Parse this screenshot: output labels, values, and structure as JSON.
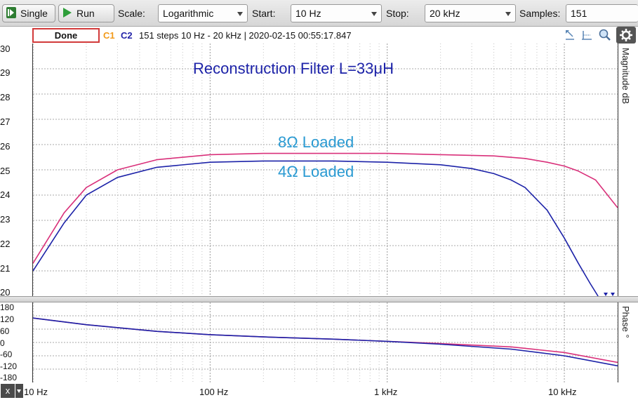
{
  "toolbar": {
    "single_label": "Single",
    "run_label": "Run",
    "scale_label": "Scale:",
    "scale_value": "Logarithmic",
    "start_label": "Start:",
    "start_value": "10 Hz",
    "stop_label": "Stop:",
    "stop_value": "20 kHz",
    "samples_label": "Samples:",
    "samples_value": "151"
  },
  "status": {
    "state": "Done",
    "c1": "C1",
    "c2": "C2",
    "info": "151 steps  10 Hz - 20 kHz | 2020-02-15 00:55:17.847",
    "icons": [
      "cursor-left-icon",
      "cursor-baseline-icon",
      "zoom-icon",
      "gear-icon"
    ]
  },
  "colors": {
    "c1": "#f29a1a",
    "c2": "#2323a8",
    "trace_8ohm": "#d9307a",
    "trace_4ohm": "#1c22a8",
    "annotation_title": "#1c22a8",
    "annotation_loads": "#2a9ad2"
  },
  "annotations": {
    "title": "Reconstruction   Filter L=33μH",
    "load_8": "8Ω  Loaded",
    "load_4": "4Ω  Loaded"
  },
  "axes": {
    "mag_label": "Magnitude dB",
    "phase_label": "Phase °",
    "x_ticks": [
      "10 Hz",
      "100 Hz",
      "1 kHz",
      "10 kHz"
    ],
    "mag_ticks": [
      "30",
      "29",
      "28",
      "27",
      "26",
      "25",
      "24",
      "23",
      "22",
      "21",
      "20"
    ],
    "phase_ticks": [
      "180",
      "120",
      "60",
      "0",
      "-60",
      "-120",
      "-180"
    ]
  },
  "bottom": {
    "x_button": "x"
  },
  "chart_data": [
    {
      "type": "line",
      "xscale": "log",
      "xlim": [
        10,
        20000
      ],
      "ylim": [
        20,
        30
      ],
      "ylabel": "Magnitude dB",
      "series": [
        {
          "name": "8Ω  Loaded",
          "color": "#d9307a",
          "x": [
            10,
            15,
            20,
            30,
            50,
            100,
            200,
            500,
            1000,
            2000,
            4000,
            6000,
            8000,
            10000,
            12000,
            15000,
            20000
          ],
          "y": [
            21.3,
            23.3,
            24.3,
            25.0,
            25.4,
            25.6,
            25.65,
            25.65,
            25.65,
            25.6,
            25.55,
            25.45,
            25.3,
            25.15,
            24.95,
            24.6,
            23.5
          ]
        },
        {
          "name": "4Ω  Loaded",
          "color": "#1c22a8",
          "x": [
            10,
            15,
            20,
            30,
            50,
            100,
            200,
            500,
            1000,
            2000,
            3000,
            4000,
            5000,
            6000,
            8000,
            10000,
            12000,
            14000,
            15500
          ],
          "y": [
            21.0,
            22.9,
            24.0,
            24.7,
            25.1,
            25.3,
            25.35,
            25.35,
            25.3,
            25.2,
            25.05,
            24.85,
            24.6,
            24.3,
            23.4,
            22.3,
            21.3,
            20.5,
            20.0
          ]
        }
      ]
    },
    {
      "type": "line",
      "xscale": "log",
      "xlim": [
        10,
        20000
      ],
      "ylim": [
        -180,
        180
      ],
      "ylabel": "Phase °",
      "series": [
        {
          "name": "8Ω  Loaded",
          "color": "#d9307a",
          "x": [
            10,
            20,
            50,
            100,
            200,
            500,
            1000,
            2000,
            5000,
            10000,
            20000
          ],
          "y": [
            110,
            80,
            50,
            35,
            25,
            15,
            5,
            -5,
            -20,
            -45,
            -90
          ]
        },
        {
          "name": "4Ω  Loaded",
          "color": "#1c22a8",
          "x": [
            10,
            20,
            50,
            100,
            200,
            500,
            1000,
            2000,
            5000,
            10000,
            20000
          ],
          "y": [
            110,
            80,
            50,
            35,
            25,
            15,
            5,
            -8,
            -30,
            -60,
            -105
          ]
        }
      ]
    }
  ]
}
